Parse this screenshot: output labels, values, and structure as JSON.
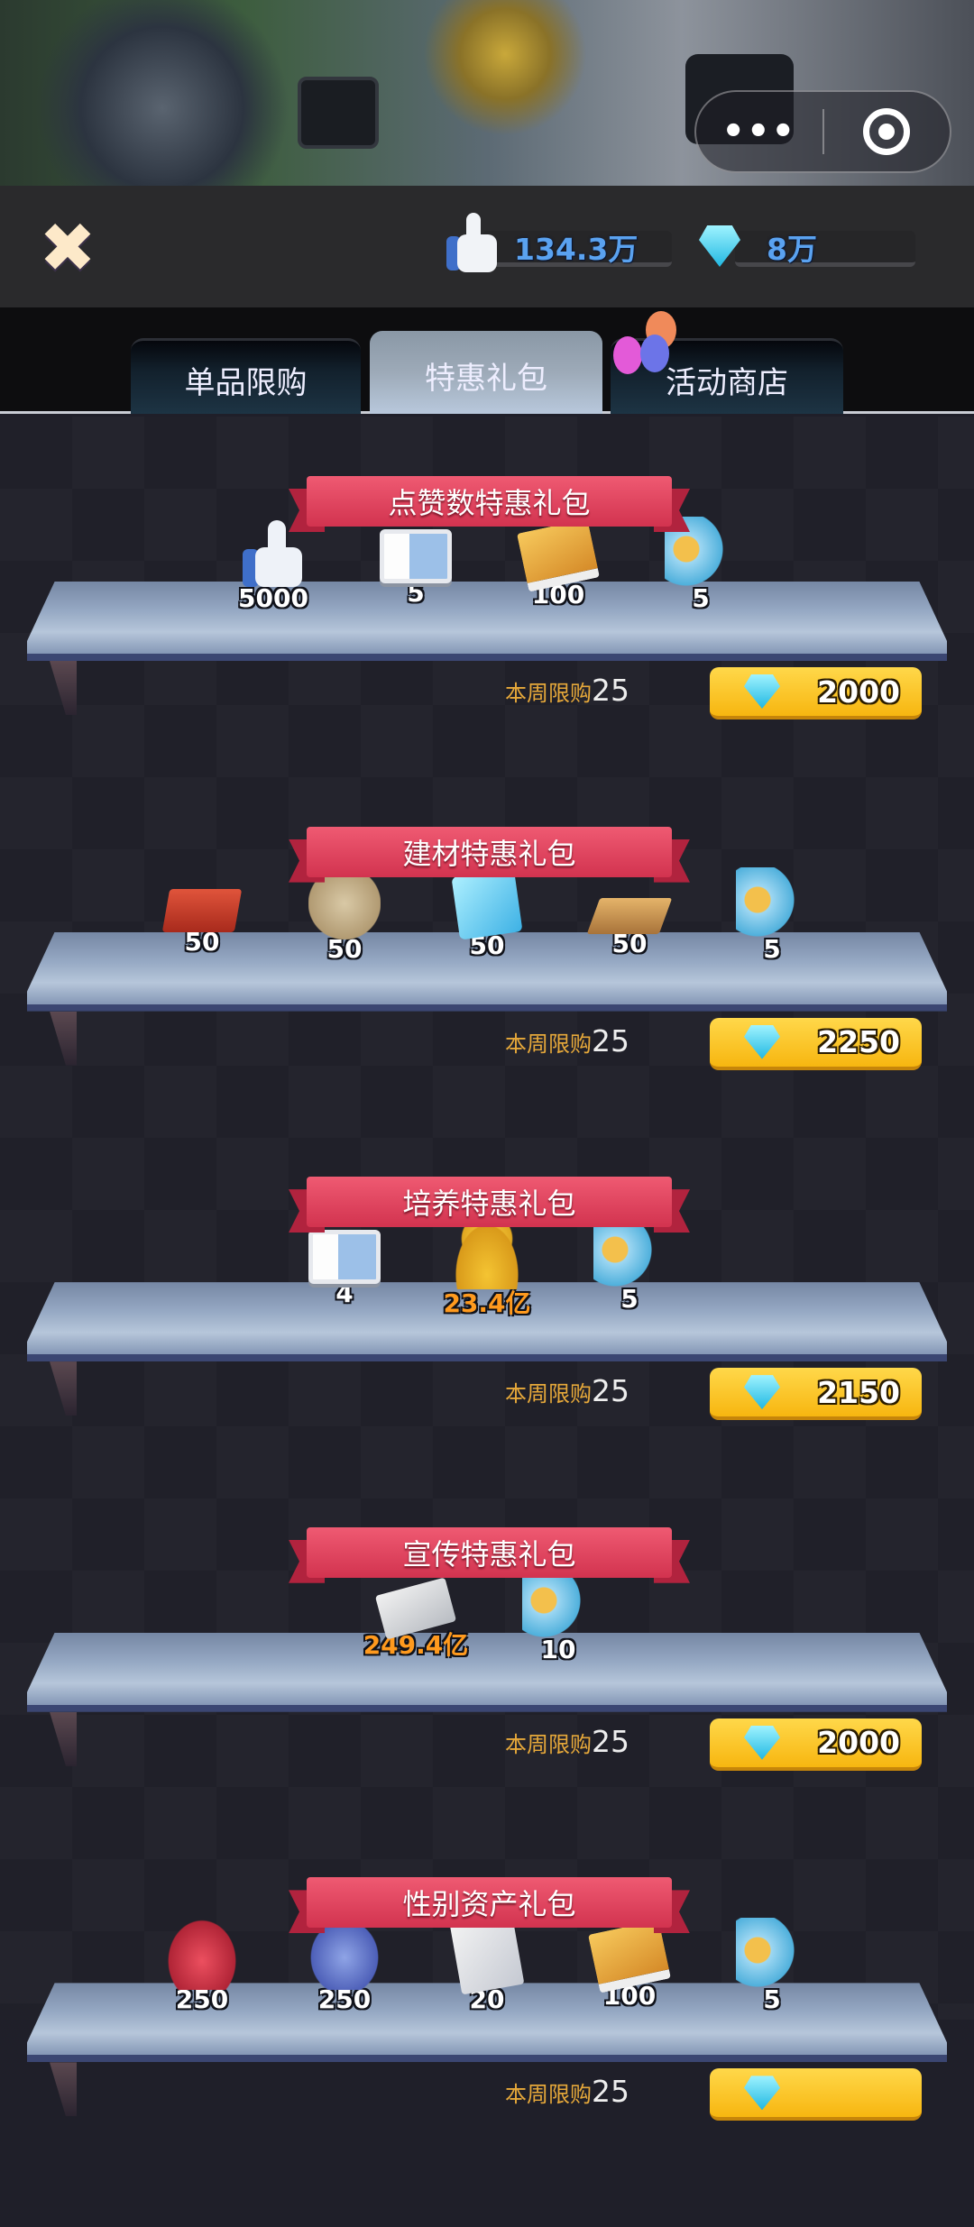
{
  "top_bar": {
    "menu_dots": "•••"
  },
  "header": {
    "likes_value": "134.3万",
    "diamonds_value": "8万"
  },
  "tabs": [
    {
      "label": "单品限购",
      "active": false
    },
    {
      "label": "特惠礼包",
      "active": true
    },
    {
      "label": "活动商店",
      "active": false
    }
  ],
  "packs": [
    {
      "title": "点赞数特惠礼包",
      "items": [
        {
          "icon": "thumbs-up",
          "qty": "5000"
        },
        {
          "icon": "id-card",
          "qty": "5"
        },
        {
          "icon": "movie-magazine",
          "qty": "100"
        },
        {
          "icon": "megaphone",
          "qty": "5"
        }
      ],
      "limit_label": "本周限购",
      "limit_value": "25",
      "price": "2000"
    },
    {
      "title": "建材特惠礼包",
      "items": [
        {
          "icon": "bricks",
          "qty": "50"
        },
        {
          "icon": "cement-bag",
          "qty": "50"
        },
        {
          "icon": "glass",
          "qty": "50"
        },
        {
          "icon": "wood-planks",
          "qty": "50"
        },
        {
          "icon": "megaphone",
          "qty": "5"
        }
      ],
      "limit_label": "本周限购",
      "limit_value": "25",
      "price": "2250"
    },
    {
      "title": "培养特惠礼包",
      "items": [
        {
          "icon": "id-card",
          "qty": "4"
        },
        {
          "icon": "gold-coins",
          "qty": "23.4亿"
        },
        {
          "icon": "megaphone",
          "qty": "5"
        }
      ],
      "limit_label": "本周限购",
      "limit_value": "25",
      "price": "2150"
    },
    {
      "title": "宣传特惠礼包",
      "items": [
        {
          "icon": "cash-stack",
          "qty": "249.4亿"
        },
        {
          "icon": "megaphone",
          "qty": "10"
        }
      ],
      "limit_label": "本周限购",
      "limit_value": "25",
      "price": "2000"
    },
    {
      "title": "性别资产礼包",
      "items": [
        {
          "icon": "purse",
          "qty": "250"
        },
        {
          "icon": "helmet",
          "qty": "250"
        },
        {
          "icon": "blueprint",
          "qty": "20"
        },
        {
          "icon": "movie-magazine",
          "qty": "100"
        },
        {
          "icon": "megaphone",
          "qty": "5"
        }
      ],
      "limit_label": "本周限购",
      "limit_value": "25",
      "price": ""
    }
  ],
  "colors": {
    "ribbon": "#d2334f",
    "price_button": "#f7b610",
    "currency_text": "#5aa2f0",
    "orange_qty": "#ff9a1e"
  }
}
